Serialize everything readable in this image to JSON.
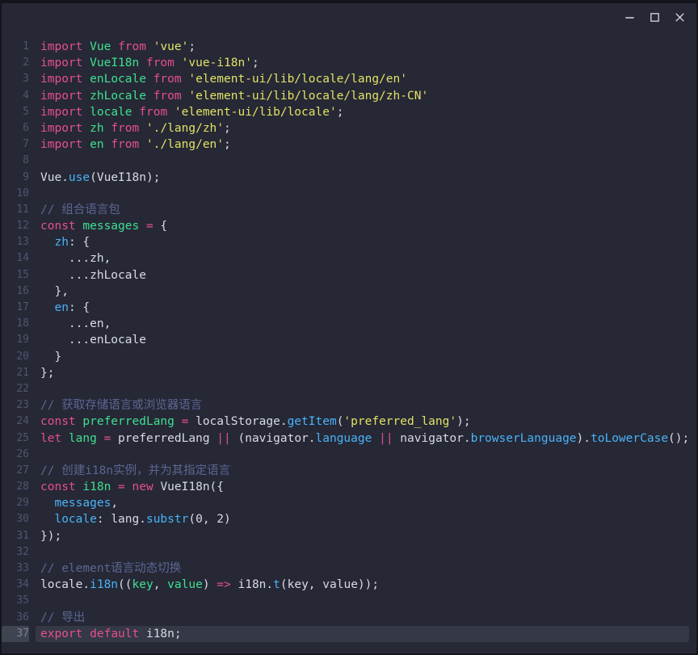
{
  "window": {
    "titlebar": {
      "controls": [
        {
          "name": "minimize"
        },
        {
          "name": "maximize"
        },
        {
          "name": "close"
        }
      ]
    }
  },
  "editor": {
    "colors": {
      "bg": "#262836",
      "gutter": "#4e5670",
      "gutterActive": "#7c829a",
      "gutterActiveBg": "#3f4452",
      "lineHighlight": "#343847",
      "kw": "#e5508c",
      "id": "#3ee08f",
      "str": "#e2e264",
      "prop": "#4ab3f7",
      "cmt": "#5d6692",
      "pln": "#d8dbe4",
      "controlIcon": "#d6d8e0"
    },
    "lines": [
      {
        "n": "1",
        "tokens": [
          [
            "kw",
            "import"
          ],
          [
            "pln",
            " "
          ],
          [
            "id",
            "Vue"
          ],
          [
            "pln",
            " "
          ],
          [
            "kw",
            "from"
          ],
          [
            "pln",
            " "
          ],
          [
            "str",
            "'vue'"
          ],
          [
            "pln",
            ";"
          ]
        ]
      },
      {
        "n": "2",
        "tokens": [
          [
            "kw",
            "import"
          ],
          [
            "pln",
            " "
          ],
          [
            "id",
            "VueI18n"
          ],
          [
            "pln",
            " "
          ],
          [
            "kw",
            "from"
          ],
          [
            "pln",
            " "
          ],
          [
            "str",
            "'vue-i18n'"
          ],
          [
            "pln",
            ";"
          ]
        ]
      },
      {
        "n": "3",
        "tokens": [
          [
            "kw",
            "import"
          ],
          [
            "pln",
            " "
          ],
          [
            "id",
            "enLocale"
          ],
          [
            "pln",
            " "
          ],
          [
            "kw",
            "from"
          ],
          [
            "pln",
            " "
          ],
          [
            "str",
            "'element-ui/lib/locale/lang/en'"
          ]
        ]
      },
      {
        "n": "4",
        "tokens": [
          [
            "kw",
            "import"
          ],
          [
            "pln",
            " "
          ],
          [
            "id",
            "zhLocale"
          ],
          [
            "pln",
            " "
          ],
          [
            "kw",
            "from"
          ],
          [
            "pln",
            " "
          ],
          [
            "str",
            "'element-ui/lib/locale/lang/zh-CN'"
          ]
        ]
      },
      {
        "n": "5",
        "tokens": [
          [
            "kw",
            "import"
          ],
          [
            "pln",
            " "
          ],
          [
            "id",
            "locale"
          ],
          [
            "pln",
            " "
          ],
          [
            "kw",
            "from"
          ],
          [
            "pln",
            " "
          ],
          [
            "str",
            "'element-ui/lib/locale'"
          ],
          [
            "pln",
            ";"
          ]
        ]
      },
      {
        "n": "6",
        "tokens": [
          [
            "kw",
            "import"
          ],
          [
            "pln",
            " "
          ],
          [
            "id",
            "zh"
          ],
          [
            "pln",
            " "
          ],
          [
            "kw",
            "from"
          ],
          [
            "pln",
            " "
          ],
          [
            "str",
            "'./lang/zh'"
          ],
          [
            "pln",
            ";"
          ]
        ]
      },
      {
        "n": "7",
        "tokens": [
          [
            "kw",
            "import"
          ],
          [
            "pln",
            " "
          ],
          [
            "id",
            "en"
          ],
          [
            "pln",
            " "
          ],
          [
            "kw",
            "from"
          ],
          [
            "pln",
            " "
          ],
          [
            "str",
            "'./lang/en'"
          ],
          [
            "pln",
            ";"
          ]
        ]
      },
      {
        "n": "8",
        "tokens": []
      },
      {
        "n": "9",
        "tokens": [
          [
            "pln",
            "Vue."
          ],
          [
            "prop",
            "use"
          ],
          [
            "pln",
            "(VueI18n);"
          ]
        ]
      },
      {
        "n": "10",
        "tokens": []
      },
      {
        "n": "11",
        "tokens": [
          [
            "cmt",
            "// 组合语言包"
          ]
        ]
      },
      {
        "n": "12",
        "tokens": [
          [
            "kw",
            "const"
          ],
          [
            "pln",
            " "
          ],
          [
            "id",
            "messages"
          ],
          [
            "pln",
            " "
          ],
          [
            "kw",
            "="
          ],
          [
            "pln",
            " {"
          ]
        ]
      },
      {
        "n": "13",
        "tokens": [
          [
            "pln",
            "  "
          ],
          [
            "prop",
            "zh"
          ],
          [
            "pln",
            ": {"
          ]
        ]
      },
      {
        "n": "14",
        "tokens": [
          [
            "pln",
            "    ...zh,"
          ]
        ]
      },
      {
        "n": "15",
        "tokens": [
          [
            "pln",
            "    ...zhLocale"
          ]
        ]
      },
      {
        "n": "16",
        "tokens": [
          [
            "pln",
            "  },"
          ]
        ]
      },
      {
        "n": "17",
        "tokens": [
          [
            "pln",
            "  "
          ],
          [
            "prop",
            "en"
          ],
          [
            "pln",
            ": {"
          ]
        ]
      },
      {
        "n": "18",
        "tokens": [
          [
            "pln",
            "    ...en,"
          ]
        ]
      },
      {
        "n": "19",
        "tokens": [
          [
            "pln",
            "    ...enLocale"
          ]
        ]
      },
      {
        "n": "20",
        "tokens": [
          [
            "pln",
            "  }"
          ]
        ]
      },
      {
        "n": "21",
        "tokens": [
          [
            "pln",
            "};"
          ]
        ]
      },
      {
        "n": "22",
        "tokens": []
      },
      {
        "n": "23",
        "tokens": [
          [
            "cmt",
            "// 获取存储语言或浏览器语言"
          ]
        ]
      },
      {
        "n": "24",
        "tokens": [
          [
            "kw",
            "const"
          ],
          [
            "pln",
            " "
          ],
          [
            "id",
            "preferredLang"
          ],
          [
            "pln",
            " "
          ],
          [
            "kw",
            "="
          ],
          [
            "pln",
            " localStorage."
          ],
          [
            "prop",
            "getItem"
          ],
          [
            "pln",
            "("
          ],
          [
            "str",
            "'preferred_lang'"
          ],
          [
            "pln",
            ");"
          ]
        ]
      },
      {
        "n": "25",
        "tokens": [
          [
            "kw",
            "let"
          ],
          [
            "pln",
            " "
          ],
          [
            "id",
            "lang"
          ],
          [
            "pln",
            " "
          ],
          [
            "kw",
            "="
          ],
          [
            "pln",
            " preferredLang "
          ],
          [
            "kw",
            "||"
          ],
          [
            "pln",
            " (navigator."
          ],
          [
            "prop",
            "language"
          ],
          [
            "pln",
            " "
          ],
          [
            "kw",
            "||"
          ],
          [
            "pln",
            " navigator."
          ],
          [
            "prop",
            "browserLanguage"
          ],
          [
            "pln",
            ")."
          ],
          [
            "prop",
            "toLowerCase"
          ],
          [
            "pln",
            "();"
          ]
        ]
      },
      {
        "n": "26",
        "tokens": []
      },
      {
        "n": "27",
        "tokens": [
          [
            "cmt",
            "// 创建i18n实例，并为其指定语言"
          ]
        ]
      },
      {
        "n": "28",
        "tokens": [
          [
            "kw",
            "const"
          ],
          [
            "pln",
            " "
          ],
          [
            "id",
            "i18n"
          ],
          [
            "pln",
            " "
          ],
          [
            "kw",
            "="
          ],
          [
            "pln",
            " "
          ],
          [
            "kw",
            "new"
          ],
          [
            "pln",
            " VueI18n({"
          ]
        ]
      },
      {
        "n": "29",
        "tokens": [
          [
            "pln",
            "  "
          ],
          [
            "prop",
            "messages"
          ],
          [
            "pln",
            ","
          ]
        ]
      },
      {
        "n": "30",
        "tokens": [
          [
            "pln",
            "  "
          ],
          [
            "prop",
            "locale"
          ],
          [
            "pln",
            ": lang."
          ],
          [
            "prop",
            "substr"
          ],
          [
            "pln",
            "(0, 2)"
          ]
        ]
      },
      {
        "n": "31",
        "tokens": [
          [
            "pln",
            "});"
          ]
        ]
      },
      {
        "n": "32",
        "tokens": []
      },
      {
        "n": "33",
        "tokens": [
          [
            "cmt",
            "// element语言动态切换"
          ]
        ]
      },
      {
        "n": "34",
        "tokens": [
          [
            "pln",
            "locale."
          ],
          [
            "prop",
            "i18n"
          ],
          [
            "pln",
            "(("
          ],
          [
            "id",
            "key"
          ],
          [
            "pln",
            ", "
          ],
          [
            "id",
            "value"
          ],
          [
            "pln",
            ") "
          ],
          [
            "kw",
            "=>"
          ],
          [
            "pln",
            " i18n."
          ],
          [
            "prop",
            "t"
          ],
          [
            "pln",
            "(key, value));"
          ]
        ]
      },
      {
        "n": "35",
        "tokens": []
      },
      {
        "n": "36",
        "tokens": [
          [
            "cmt",
            "// 导出"
          ]
        ]
      },
      {
        "n": "37",
        "tokens": [
          [
            "kw",
            "export"
          ],
          [
            "pln",
            " "
          ],
          [
            "kw",
            "default"
          ],
          [
            "pln",
            " i18n;"
          ]
        ],
        "current": true
      }
    ]
  }
}
